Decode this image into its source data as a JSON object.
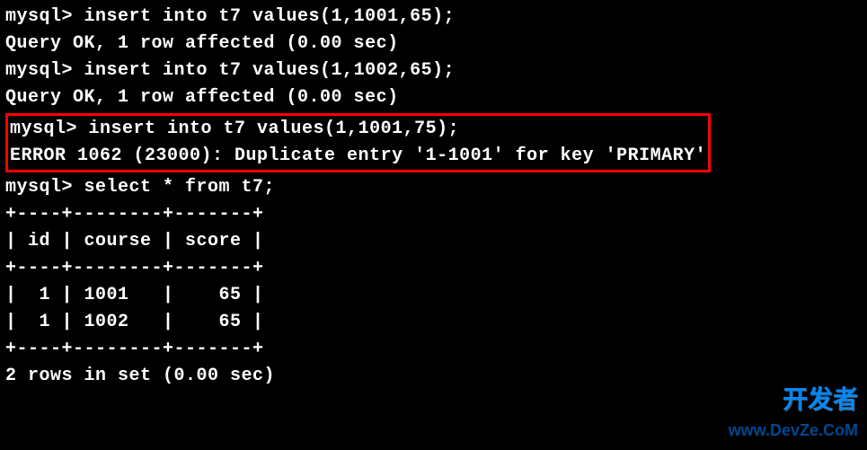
{
  "lines": {
    "l1_prompt": "mysql> ",
    "l1_cmd": "insert into t7 values(1,1001,65);",
    "l2": "Query OK, 1 row affected (0.00 sec)",
    "blank1": "",
    "l3_prompt": "mysql> ",
    "l3_cmd": "insert into t7 values(1,1002,65);",
    "l4": "Query OK, 1 row affected (0.00 sec)",
    "blank2": "",
    "l5_prompt": "mysql> ",
    "l5_cmd": "insert into t7 values(1,1001,75);",
    "l6": "ERROR 1062 (23000): Duplicate entry '1-1001' for key 'PRIMARY'",
    "l7_prompt": "mysql> ",
    "l7_cmd": "select * from t7;",
    "tbl_sep": "+----+--------+-------+",
    "tbl_head": "| id | course | score |",
    "tbl_r1": "|  1 | 1001   |    65 |",
    "tbl_r2": "|  1 | 1002   |    65 |",
    "l8": "2 rows in set (0.00 sec)"
  },
  "watermark": {
    "cn": "开发者",
    "en": "www.DevZe.CoM"
  }
}
